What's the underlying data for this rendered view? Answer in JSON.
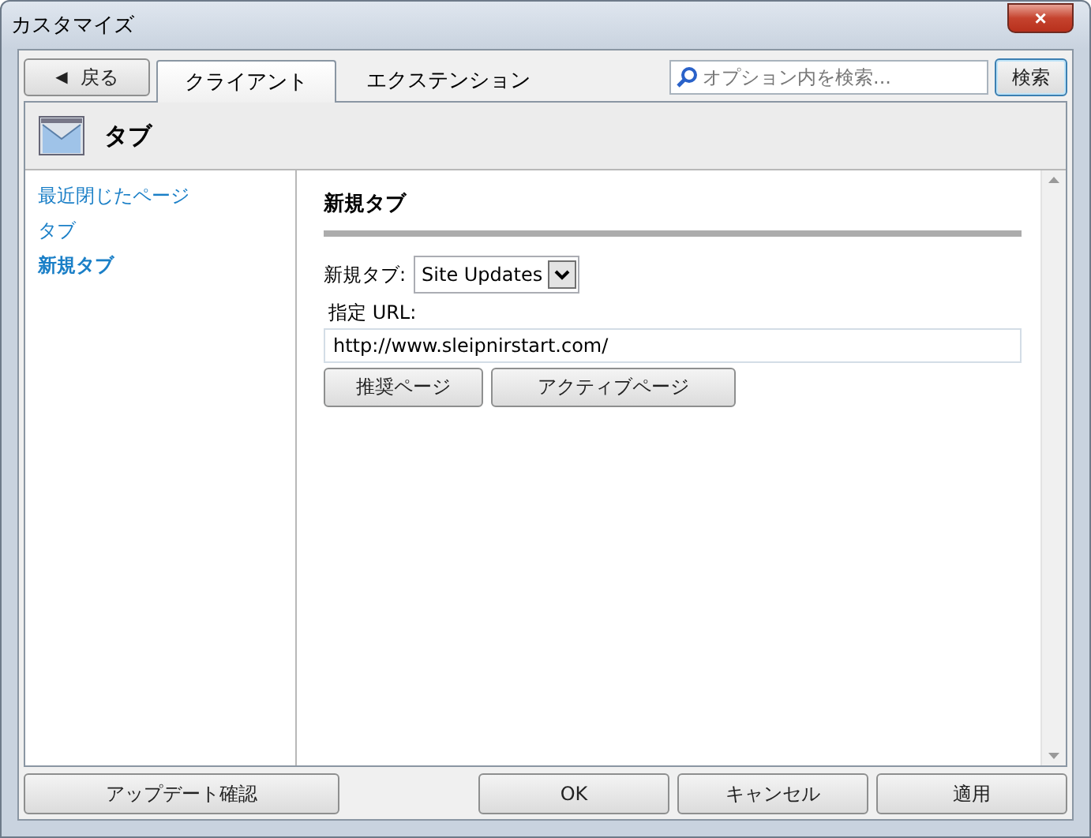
{
  "window": {
    "title": "カスタマイズ",
    "close": "×"
  },
  "toolbar": {
    "back": {
      "arrow": "◀",
      "label": "戻る"
    },
    "tabs": [
      {
        "label": "クライアント",
        "selected": true
      },
      {
        "label": "エクステンション",
        "selected": false
      }
    ],
    "search": {
      "placeholder": "オプション内を検索..."
    },
    "search_button": "検索"
  },
  "header": {
    "title": "タブ"
  },
  "sidebar": {
    "items": [
      {
        "label": "最近閉じたページ",
        "selected": false
      },
      {
        "label": "タブ",
        "selected": false
      },
      {
        "label": "新規タブ",
        "selected": true
      }
    ]
  },
  "section": {
    "title": "新規タブ",
    "dropdown_label": "新規タブ:",
    "dropdown_value": "Site Updates",
    "url_label": "指定 URL:",
    "url_value": "http://www.sleipnirstart.com/",
    "buttons": [
      "推奨ページ",
      "アクティブページ"
    ]
  },
  "footer": {
    "update_button": "アップデート確認",
    "buttons": [
      "OK",
      "キャンセル",
      "適用"
    ]
  }
}
